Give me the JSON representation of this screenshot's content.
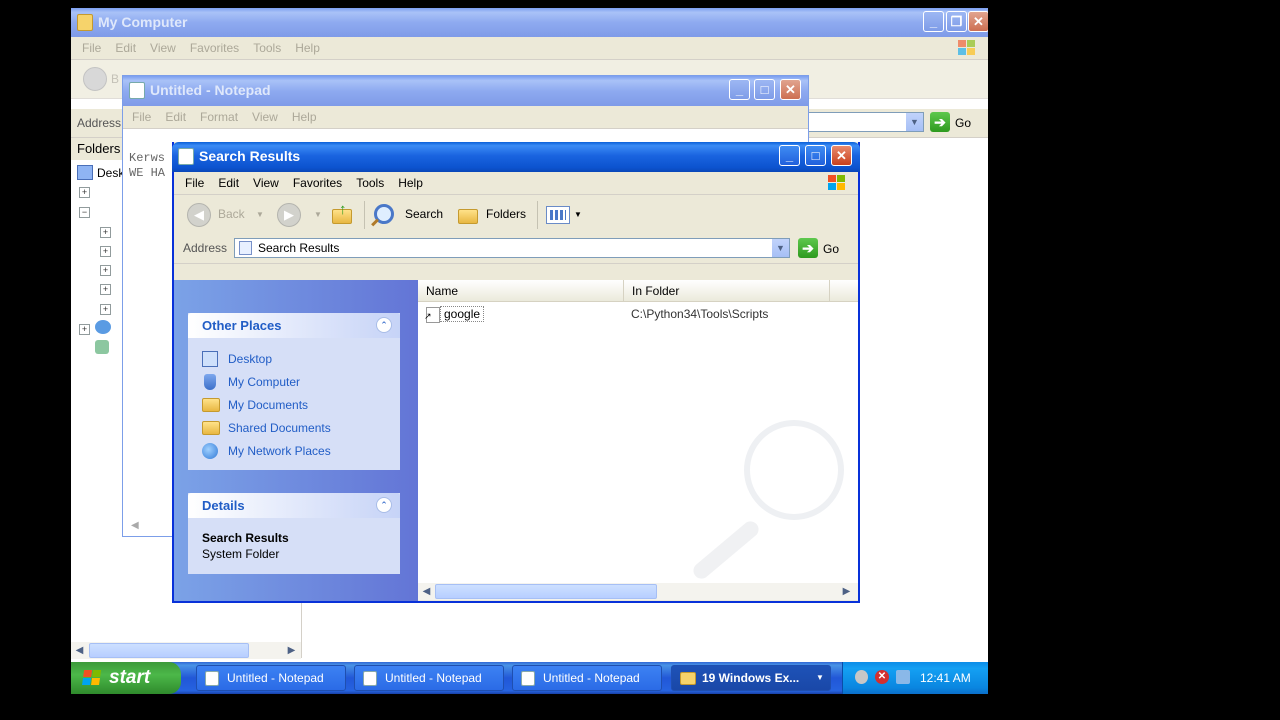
{
  "my_computer": {
    "title": "My Computer",
    "menu": [
      "File",
      "Edit",
      "View",
      "Favorites",
      "Tools",
      "Help"
    ],
    "back_partial": "B",
    "address_label": "Address",
    "go_label": "Go",
    "folders_label": "Folders",
    "tree_first": "Desk"
  },
  "notepad": {
    "title": "Untitled - Notepad",
    "menu": [
      "File",
      "Edit",
      "Format",
      "View",
      "Help"
    ],
    "text_line1": "Kerws",
    "text_line2": "WE HA"
  },
  "search": {
    "title": "Search Results",
    "menu": [
      "File",
      "Edit",
      "View",
      "Favorites",
      "Tools",
      "Help"
    ],
    "toolbar": {
      "back": "Back",
      "search": "Search",
      "folders": "Folders"
    },
    "address_label": "Address",
    "address_value": "Search Results",
    "go_label": "Go",
    "other_places": {
      "title": "Other Places",
      "items": [
        "Desktop",
        "My Computer",
        "My Documents",
        "Shared Documents",
        "My Network Places"
      ]
    },
    "details": {
      "title": "Details",
      "name": "Search Results",
      "type": "System Folder"
    },
    "columns": [
      "Name",
      "In Folder"
    ],
    "rows": [
      {
        "name": "google",
        "folder": "C:\\Python34\\Tools\\Scripts"
      }
    ]
  },
  "taskbar": {
    "start": "start",
    "items": [
      "Untitled - Notepad",
      "Untitled - Notepad",
      "Untitled - Notepad",
      "19 Windows Ex..."
    ],
    "clock": "12:41 AM"
  },
  "colors": {
    "xp_blue": "#0a5fd8",
    "link_blue": "#215dc6",
    "start_green": "#3c9a3a"
  }
}
